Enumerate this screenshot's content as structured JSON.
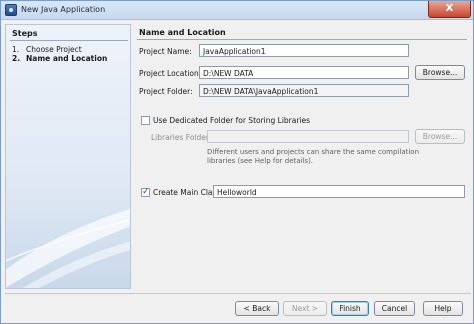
{
  "window": {
    "title": "New Java Application",
    "close_glyph": "X"
  },
  "steps": {
    "title": "Steps",
    "items": [
      {
        "num": "1.",
        "label": "Choose Project"
      },
      {
        "num": "2.",
        "label": "Name and Location"
      }
    ]
  },
  "content": {
    "title": "Name and Location",
    "project_name": {
      "label": "Project Name:",
      "value": "JavaApplication1"
    },
    "project_location": {
      "label": "Project Location:",
      "value": "D:\\NEW DATA",
      "browse_label": "Browse..."
    },
    "project_folder": {
      "label": "Project Folder:",
      "value": "D:\\NEW DATA\\JavaApplication1"
    },
    "dedicated_folder": {
      "label": "Use Dedicated Folder for Storing Libraries",
      "checked": false
    },
    "libraries_folder": {
      "label": "Libraries Folder:",
      "value": "",
      "browse_label": "Browse..."
    },
    "info_text": "Different users and projects can share the same compilation libraries (see Help for details).",
    "main_class": {
      "label": "Create Main Class",
      "checked": true,
      "value": "Helloworld"
    }
  },
  "buttons": {
    "back": "< Back",
    "next": "Next >",
    "finish": "Finish",
    "cancel": "Cancel",
    "help": "Help"
  }
}
